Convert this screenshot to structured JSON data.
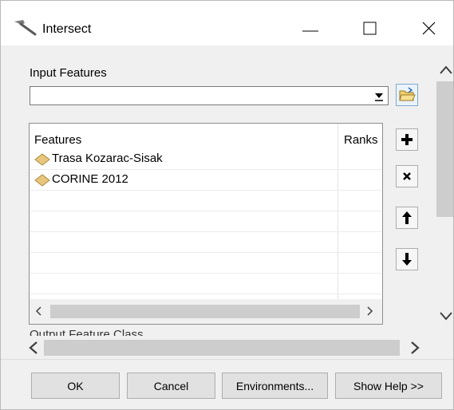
{
  "window": {
    "title": "Intersect"
  },
  "input_features": {
    "label": "Input Features",
    "value": ""
  },
  "table": {
    "columns": [
      "Features",
      "Ranks"
    ],
    "rows": [
      {
        "feature": "Trasa Kozarac-Sisak",
        "rank": "",
        "icon": "polygon-layer-icon"
      },
      {
        "feature": "CORINE 2012",
        "rank": "",
        "icon": "polygon-layer-icon"
      }
    ]
  },
  "next_section_label": "Output Feature Class",
  "buttons": {
    "ok": "OK",
    "cancel": "Cancel",
    "environments": "Environments...",
    "show_help": "Show Help >>"
  },
  "colors": {
    "layer_icon": "#e9c67d",
    "scroll_thumb": "#cdcdcd"
  }
}
